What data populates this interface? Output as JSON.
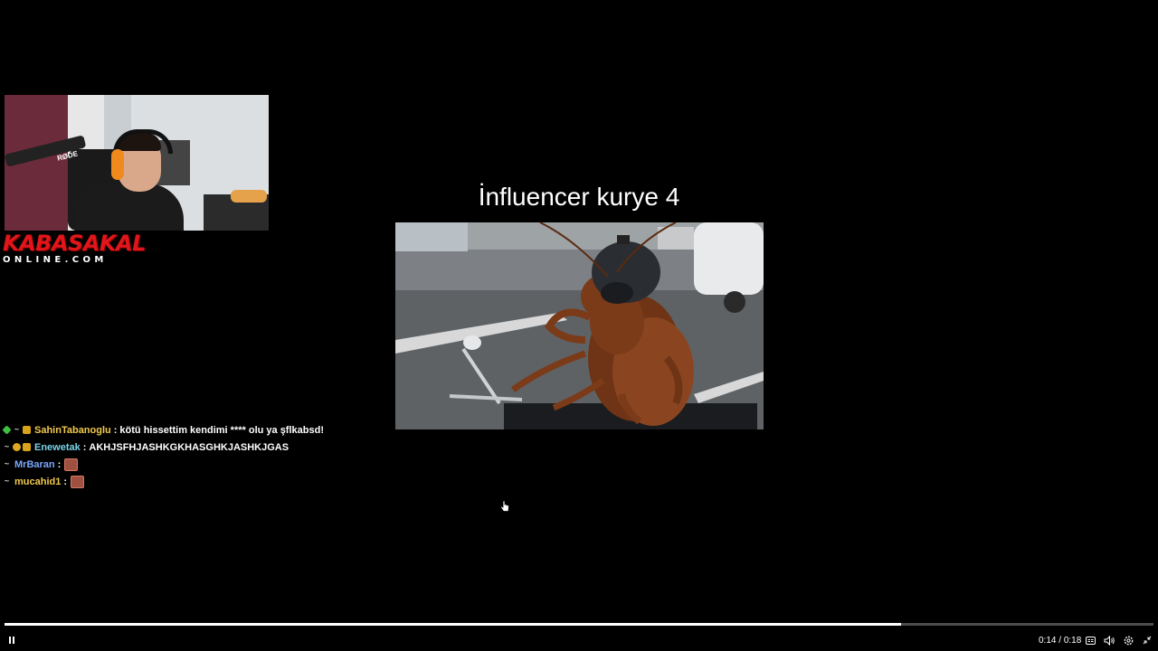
{
  "overlay": {
    "logo_main": "KABASAKAL",
    "logo_sub": "ONLINE.COM",
    "webcam_mic_tag": "RØDE"
  },
  "video": {
    "title": "İnfluencer kurye 4",
    "progress_fraction": 0.78
  },
  "chat": {
    "messages": [
      {
        "user": "SahinTabanoglu",
        "user_color": "#f2c94c",
        "text": "kötü hissettim kendimi **** olu ya şflkabsd!"
      },
      {
        "user": "Enewetak",
        "user_color": "#7ad3e8",
        "text": "AKHJSFHJASHKGKHASGHKJASHKJGAS"
      },
      {
        "user": "MrBaran",
        "user_color": "#7aa7ff",
        "text": ""
      },
      {
        "user": "mucahid1",
        "user_color": "#f2c94c",
        "text": ""
      }
    ]
  },
  "controls": {
    "current_time": "0:14",
    "separator": "/",
    "duration": "0:18",
    "icons": [
      "pause-icon",
      "captions-icon",
      "volume-icon",
      "settings-icon",
      "exit-fullscreen-icon"
    ]
  }
}
